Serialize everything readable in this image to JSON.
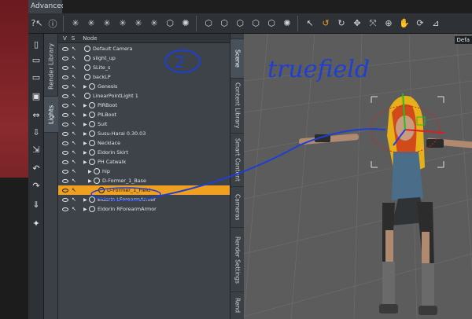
{
  "window": {
    "tab_label": "Advanced"
  },
  "scene": {
    "columns": {
      "visible": "V",
      "selectable": "S",
      "node": "Node"
    },
    "nodes": [
      {
        "label": "Default Camera"
      },
      {
        "label": "slight_up"
      },
      {
        "label": "SLite_s"
      },
      {
        "label": "backLP"
      },
      {
        "label": "Genesis"
      },
      {
        "label": "LinearPointLight 1"
      },
      {
        "label": "PIRBoot"
      },
      {
        "label": "PILBoot"
      },
      {
        "label": "Suit"
      },
      {
        "label": "Susu-Harai 0.30.03"
      },
      {
        "label": "Necklace"
      },
      {
        "label": "Eldorin Skirt"
      },
      {
        "label": "PH Catwalk"
      },
      {
        "label": "hip"
      },
      {
        "label": "D-Former_1_Base"
      },
      {
        "label": "D-Former_1_Field"
      },
      {
        "label": "Eldorin LForearmArmor"
      },
      {
        "label": "Eldorin RForearmArmor"
      }
    ]
  },
  "left_tabs": [
    "Render Library",
    "Lights"
  ],
  "right_tabs": [
    "Scene",
    "Content Library",
    "Smart Content",
    "Cameras",
    "Render Settings",
    "Rend"
  ],
  "viewport": {
    "corner_label": "Defa"
  },
  "annotations": {
    "number": "2",
    "handwritten": "truefield"
  },
  "colors": {
    "selection": "#f0a020",
    "annotation": "#1f3fd0"
  }
}
